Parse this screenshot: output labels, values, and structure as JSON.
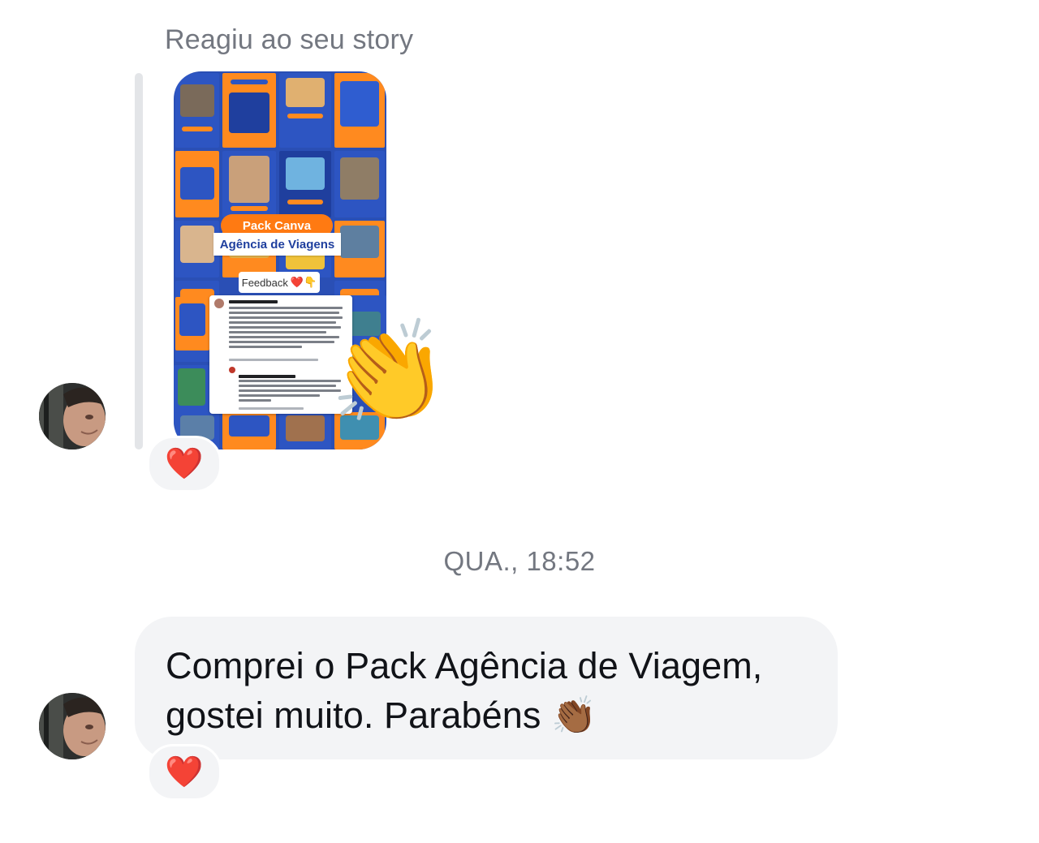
{
  "story_reply": {
    "label": "Reagiu ao seu story",
    "story": {
      "pack_label": "Pack Canva",
      "agency_label": "Agência de Viagens",
      "feedback_label": "Feedback",
      "feedback_emojis": "❤️👇",
      "sticker_emoji": "👏"
    },
    "reaction_emoji": "❤️"
  },
  "timestamp": "QUA., 18:52",
  "message": {
    "text": "Comprei o Pack Agência de Viagem, gostei muito. Parabéns 👏🏾",
    "reaction_emoji": "❤️"
  },
  "colors": {
    "bubble_bg": "#f3f4f6",
    "meta_text": "#737780",
    "story_blue": "#2a4fb5",
    "story_orange": "#ff7a12"
  }
}
